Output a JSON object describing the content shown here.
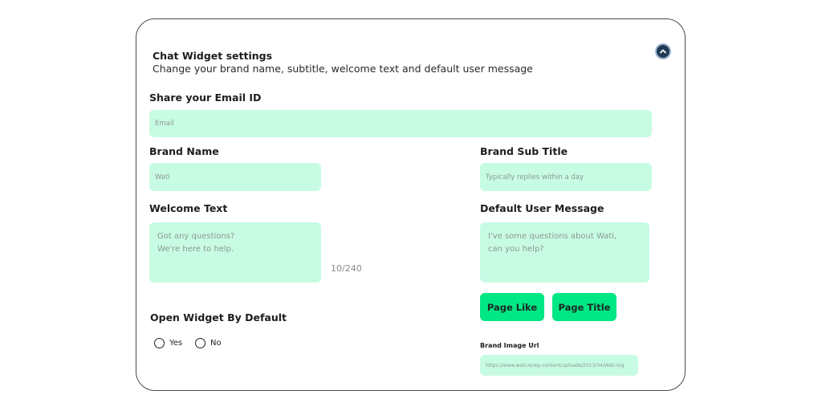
{
  "header": {
    "title": "Chat Widget settings",
    "subtitle": "Change your brand name, subtitle, welcome text and default user message",
    "collapse_icon": "chevron-up-icon"
  },
  "email": {
    "label": "Share your Email ID",
    "placeholder": "Email",
    "value": ""
  },
  "brand_name": {
    "label": "Brand Name",
    "placeholder": "Wati",
    "value": ""
  },
  "brand_subtitle": {
    "label": "Brand Sub Title",
    "placeholder": "Typically replies within a day",
    "value": ""
  },
  "welcome_text": {
    "label": "Welcome Text",
    "placeholder": "Got any questions?\nWe're here to help.",
    "counter": "10/240"
  },
  "default_message": {
    "label": "Default User Message",
    "placeholder": "I've some questions about Wati,\ncan you help?"
  },
  "buttons": {
    "page_like": "Page Like",
    "page_title": "Page Title"
  },
  "open_widget": {
    "label": "Open Widget By Default",
    "options": [
      "Yes",
      "No"
    ],
    "selected": null
  },
  "brand_image": {
    "label": "Brand Image Url",
    "placeholder": "https://www.wati.io/wp-content/uploads/2023/04/Wati-log"
  },
  "colors": {
    "field_bg": "#c8fbe3",
    "button_bg": "#00e785",
    "collapse_bg": "#1f3b55"
  }
}
